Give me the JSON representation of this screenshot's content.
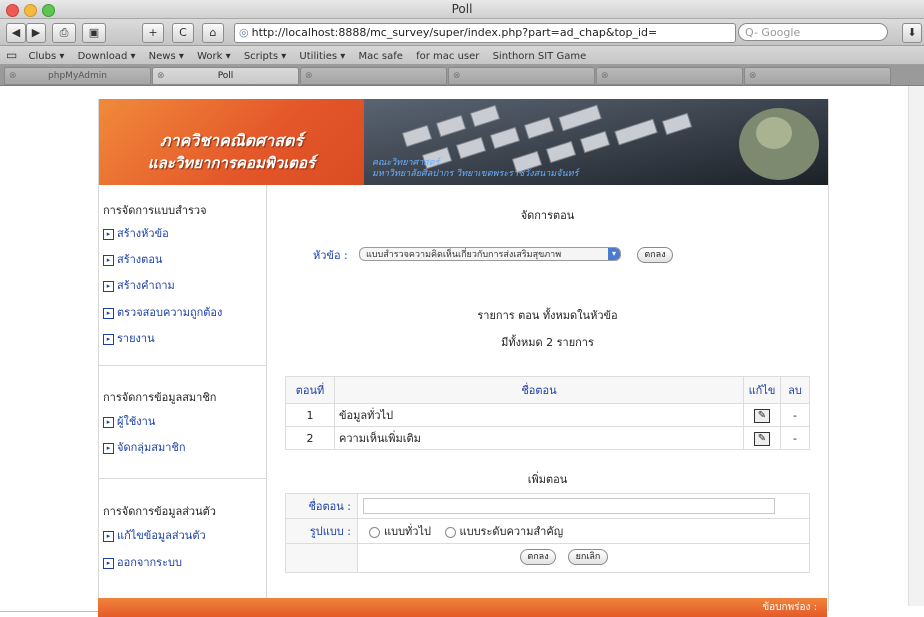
{
  "window": {
    "title": "Poll"
  },
  "toolbar": {
    "back": "◀",
    "forward": "▶",
    "print": "⎙",
    "screenshot": "▣",
    "add": "+",
    "reload": "C",
    "home": "⌂",
    "url": "http://localhost:8888/mc_survey/super/index.php?part=ad_chap&top_id=",
    "search_placeholder": "Q- Google",
    "download": "⬇"
  },
  "bookmarks": {
    "items": [
      "Clubs ▾",
      "Download ▾",
      "News ▾",
      "Work ▾",
      "Scripts ▾",
      "Utilities ▾",
      "Mac safe",
      "for mac user",
      "Sinthorn SIT Game"
    ]
  },
  "tabs": [
    {
      "label": "phpMyAdmin"
    },
    {
      "label": "Poll",
      "active": true
    },
    {
      "label": ""
    },
    {
      "label": ""
    },
    {
      "label": ""
    },
    {
      "label": ""
    }
  ],
  "banner": {
    "line1": "ภาควิชาคณิตศาสตร์",
    "line2": "และวิทยาการคอมพิวเตอร์",
    "sub1": "คณะวิทยาศาสตร์",
    "sub2": "มหาวิทยาลัยศิลปากร วิทยาเขตพระราชวังสนามจันทร์"
  },
  "sidebar": {
    "group1_title": "การจัดการแบบสำรวจ",
    "group1": [
      "สร้างหัวข้อ",
      "สร้างตอน",
      "สร้างคำถาม",
      "ตรวจสอบความถูกต้อง",
      "รายงาน"
    ],
    "group2_title": "การจัดการข้อมูลสมาชิก",
    "group2": [
      "ผู้ใช้งาน",
      "จัดกลุ่มสมาชิก"
    ],
    "group3_title": "การจัดการข้อมูลส่วนตัว",
    "group3": [
      "แก้ไขข้อมูลส่วนตัว",
      "ออกจากระบบ"
    ]
  },
  "main": {
    "heading": "จัดการตอน",
    "topic_label": "หัวข้อ :",
    "topic_value": "แบบสำรวจความคิดเห็นเกี่ยวกับการส่งเสริมสุขภาพ",
    "ok_button": "ตกลง",
    "list_title": "รายการ ตอน ทั้งหมดในหัวข้อ",
    "list_count": "มีทั้งหมด 2 รายการ",
    "table": {
      "headers": [
        "ตอนที่",
        "ชื่อตอน",
        "แก้ไข",
        "ลบ"
      ],
      "rows": [
        {
          "num": "1",
          "name": "ข้อมูลทั่วไป",
          "edit": "✎",
          "del": "-"
        },
        {
          "num": "2",
          "name": "ความเห็นเพิ่มเติม",
          "edit": "✎",
          "del": "-"
        }
      ]
    },
    "add_heading": "เพิ่มตอน",
    "form": {
      "name_label": "ชื่อตอน :",
      "name_value": "",
      "type_label": "รูปแบบ :",
      "type_option1": "แบบทั่วไป",
      "type_option2": "แบบระดับความสำคัญ",
      "submit": "ตกลง",
      "cancel": "ยกเลิก"
    }
  },
  "footer": {
    "text": "ข้อบกพร่อง :"
  }
}
